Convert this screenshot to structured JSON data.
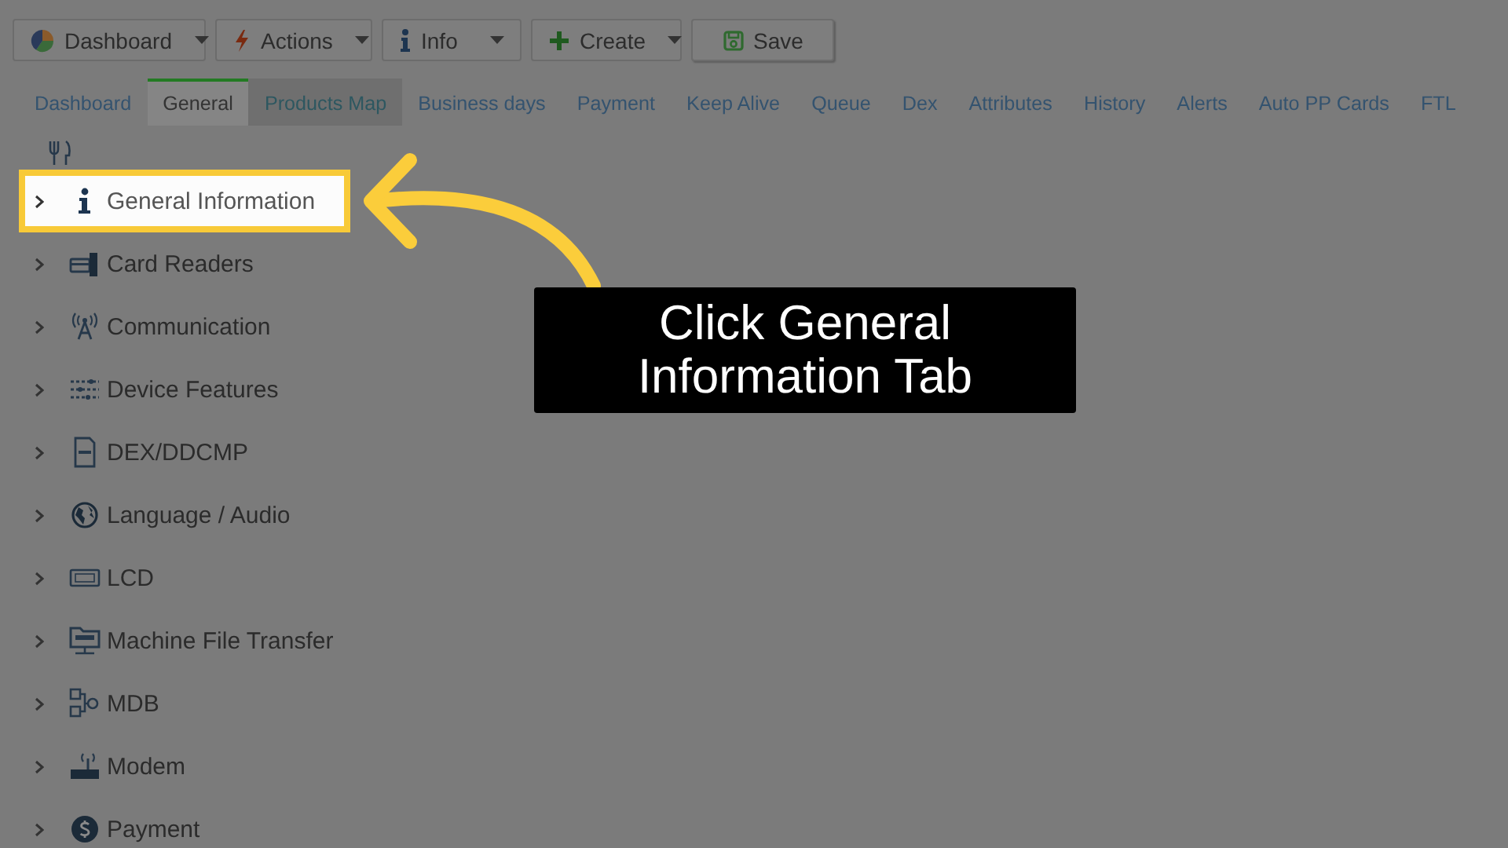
{
  "toolbar": [
    {
      "label": "Dashboard",
      "dropdown": true
    },
    {
      "label": "Actions",
      "dropdown": true
    },
    {
      "label": "Info",
      "dropdown": true
    },
    {
      "label": "Create",
      "dropdown": true
    },
    {
      "label": "Save",
      "dropdown": false
    }
  ],
  "tabs": [
    {
      "label": "Dashboard",
      "selected": false,
      "hovered": false
    },
    {
      "label": "General",
      "selected": true,
      "hovered": false
    },
    {
      "label": "Products Map",
      "selected": false,
      "hovered": true
    },
    {
      "label": "Business days",
      "selected": false,
      "hovered": false
    },
    {
      "label": "Payment",
      "selected": false,
      "hovered": false
    },
    {
      "label": "Keep Alive",
      "selected": false,
      "hovered": false
    },
    {
      "label": "Queue",
      "selected": false,
      "hovered": false
    },
    {
      "label": "Dex",
      "selected": false,
      "hovered": false
    },
    {
      "label": "Attributes",
      "selected": false,
      "hovered": false
    },
    {
      "label": "History",
      "selected": false,
      "hovered": false
    },
    {
      "label": "Alerts",
      "selected": false,
      "hovered": false
    },
    {
      "label": "Auto PP Cards",
      "selected": false,
      "hovered": false
    },
    {
      "label": "FTL",
      "selected": false,
      "hovered": false
    }
  ],
  "tree": [
    {
      "label": "General Information",
      "highlighted": true,
      "expanded": false
    },
    {
      "label": "Card Readers",
      "highlighted": false,
      "expanded": false
    },
    {
      "label": "Communication",
      "highlighted": false,
      "expanded": false
    },
    {
      "label": "Device Features",
      "highlighted": false,
      "expanded": false
    },
    {
      "label": "DEX/DDCMP",
      "highlighted": false,
      "expanded": false
    },
    {
      "label": "Language / Audio",
      "highlighted": false,
      "expanded": false
    },
    {
      "label": "LCD",
      "highlighted": false,
      "expanded": false
    },
    {
      "label": "Machine File Transfer",
      "highlighted": false,
      "expanded": false
    },
    {
      "label": "MDB",
      "highlighted": false,
      "expanded": false
    },
    {
      "label": "Modem",
      "highlighted": false,
      "expanded": false
    },
    {
      "label": "Payment",
      "highlighted": false,
      "expanded": false
    }
  ],
  "callout": {
    "text": "Click General Information Tab"
  }
}
